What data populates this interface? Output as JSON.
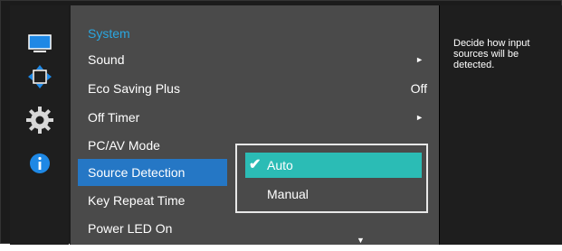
{
  "menu": {
    "category": "System",
    "items": [
      {
        "label": "Sound",
        "value": "",
        "arrow": "►"
      },
      {
        "label": "Eco Saving Plus",
        "value": "Off",
        "arrow": ""
      },
      {
        "label": "Off Timer",
        "value": "",
        "arrow": "►"
      },
      {
        "label": "PC/AV Mode",
        "value": "",
        "arrow": ""
      },
      {
        "label": "Source Detection",
        "value": "",
        "arrow": ""
      },
      {
        "label": "Key Repeat Time",
        "value": "",
        "arrow": ""
      },
      {
        "label": "Power LED On",
        "value": "",
        "arrow": ""
      }
    ],
    "selected_item": "Source Detection",
    "scroll_indicator": "▼"
  },
  "submenu": {
    "checkmark": "✔",
    "options": [
      {
        "label": "Auto"
      },
      {
        "label": "Manual"
      }
    ],
    "selected_option": "Auto"
  },
  "help": {
    "text": "Decide how input sources will be detected."
  },
  "icons": [
    "monitor-icon",
    "position-icon",
    "settings-gear-icon",
    "info-icon"
  ],
  "colors": {
    "category": "#2aa6e0",
    "selected_row": "#2577c5",
    "selected_option": "#2bbcb5",
    "menu_bg": "#4a4a4a",
    "rail_bg": "#1e1e1e"
  }
}
